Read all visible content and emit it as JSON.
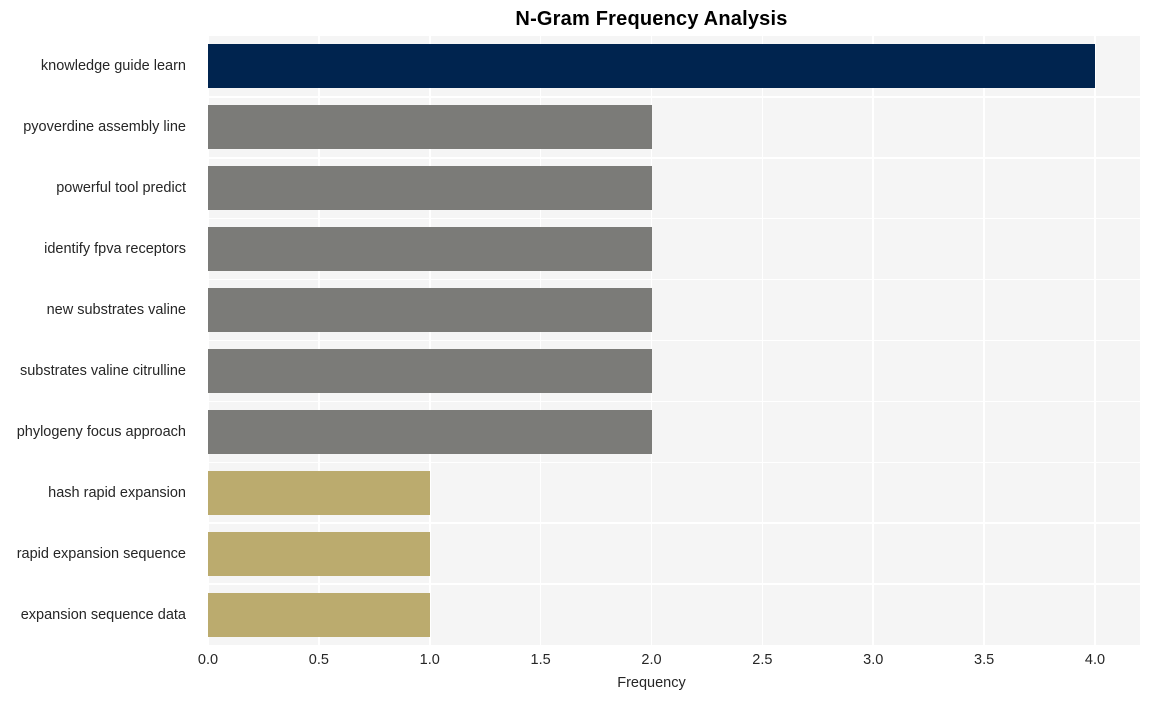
{
  "chart_data": {
    "type": "bar",
    "orientation": "horizontal",
    "title": "N-Gram Frequency Analysis",
    "xlabel": "Frequency",
    "ylabel": "",
    "categories": [
      "knowledge guide learn",
      "pyoverdine assembly line",
      "powerful tool predict",
      "identify fpva receptors",
      "new substrates valine",
      "substrates valine citrulline",
      "phylogeny focus approach",
      "hash rapid expansion",
      "rapid expansion sequence",
      "expansion sequence data"
    ],
    "values": [
      4,
      2,
      2,
      2,
      2,
      2,
      2,
      1,
      1,
      1
    ],
    "bar_colors": [
      "#00244f",
      "#7b7b78",
      "#7b7b78",
      "#7b7b78",
      "#7b7b78",
      "#7b7b78",
      "#7b7b78",
      "#bbab6e",
      "#bbab6e",
      "#bbab6e"
    ],
    "xlim": [
      0,
      4
    ],
    "xticks": [
      0,
      0.5,
      1,
      1.5,
      2,
      2.5,
      3,
      3.5,
      4
    ],
    "xtick_labels": [
      "0.0",
      "0.5",
      "1.0",
      "1.5",
      "2.0",
      "2.5",
      "3.0",
      "3.5",
      "4.0"
    ],
    "grid": true,
    "grid_color": "#ffffff",
    "plot_background": "#f5f5f5",
    "figure_background": "#ffffff",
    "legend": null,
    "title_color": "#000000",
    "tick_label_color": "#262626"
  }
}
